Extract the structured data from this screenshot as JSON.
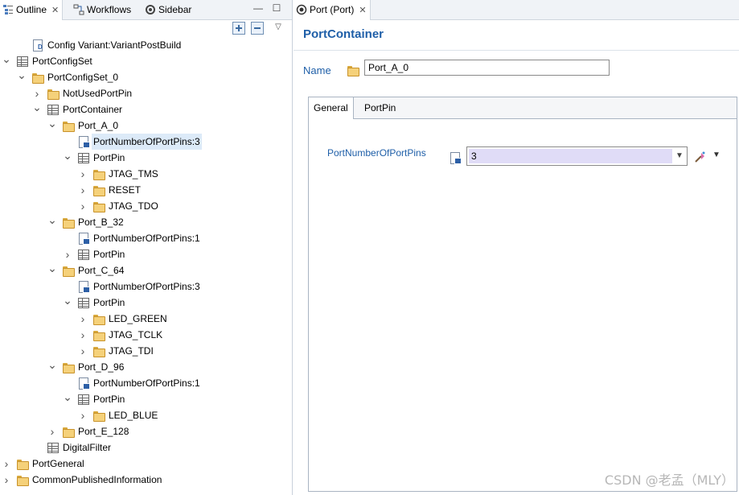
{
  "left_tabs": [
    {
      "label": "Outline",
      "icon": "outline-icon",
      "active": true,
      "closable": true
    },
    {
      "label": "Workflows",
      "icon": "workflows-icon",
      "active": false
    },
    {
      "label": "Sidebar",
      "icon": "sidebar-icon",
      "active": false
    }
  ],
  "tree": [
    {
      "label": "Config Variant:VariantPostBuild",
      "icon": "variant-doc-icon",
      "level": 1,
      "expander": "none"
    },
    {
      "label": "PortConfigSet",
      "icon": "table-icon",
      "level": 0,
      "expander": "expanded"
    },
    {
      "label": "PortConfigSet_0",
      "icon": "folder-icon",
      "level": 1,
      "expander": "expanded"
    },
    {
      "label": "NotUsedPortPin",
      "icon": "folder-icon",
      "level": 2,
      "expander": "collapsed"
    },
    {
      "label": "PortContainer",
      "icon": "table-icon",
      "level": 2,
      "expander": "expanded"
    },
    {
      "label": "Port_A_0",
      "icon": "folder-icon",
      "level": 3,
      "expander": "expanded"
    },
    {
      "label": "PortNumberOfPortPins:3",
      "icon": "parameter-icon",
      "level": 4,
      "expander": "none",
      "selected": true
    },
    {
      "label": "PortPin",
      "icon": "table-icon",
      "level": 4,
      "expander": "expanded"
    },
    {
      "label": "JTAG_TMS",
      "icon": "folder-icon",
      "level": 5,
      "expander": "collapsed"
    },
    {
      "label": "RESET",
      "icon": "folder-icon",
      "level": 5,
      "expander": "collapsed"
    },
    {
      "label": "JTAG_TDO",
      "icon": "folder-icon",
      "level": 5,
      "expander": "collapsed"
    },
    {
      "label": "Port_B_32",
      "icon": "folder-icon",
      "level": 3,
      "expander": "expanded"
    },
    {
      "label": "PortNumberOfPortPins:1",
      "icon": "parameter-icon",
      "level": 4,
      "expander": "none"
    },
    {
      "label": "PortPin",
      "icon": "table-icon",
      "level": 4,
      "expander": "collapsed"
    },
    {
      "label": "Port_C_64",
      "icon": "folder-icon",
      "level": 3,
      "expander": "expanded"
    },
    {
      "label": "PortNumberOfPortPins:3",
      "icon": "parameter-icon",
      "level": 4,
      "expander": "none"
    },
    {
      "label": "PortPin",
      "icon": "table-icon",
      "level": 4,
      "expander": "expanded"
    },
    {
      "label": "LED_GREEN",
      "icon": "folder-icon",
      "level": 5,
      "expander": "collapsed"
    },
    {
      "label": "JTAG_TCLK",
      "icon": "folder-icon",
      "level": 5,
      "expander": "collapsed"
    },
    {
      "label": "JTAG_TDI",
      "icon": "folder-icon",
      "level": 5,
      "expander": "collapsed"
    },
    {
      "label": "Port_D_96",
      "icon": "folder-icon",
      "level": 3,
      "expander": "expanded"
    },
    {
      "label": "PortNumberOfPortPins:1",
      "icon": "parameter-icon",
      "level": 4,
      "expander": "none"
    },
    {
      "label": "PortPin",
      "icon": "table-icon",
      "level": 4,
      "expander": "expanded"
    },
    {
      "label": "LED_BLUE",
      "icon": "folder-icon",
      "level": 5,
      "expander": "collapsed"
    },
    {
      "label": "Port_E_128",
      "icon": "folder-icon",
      "level": 3,
      "expander": "collapsed"
    },
    {
      "label": "DigitalFilter",
      "icon": "table-icon",
      "level": 2,
      "expander": "none"
    },
    {
      "label": "PortGeneral",
      "icon": "folder-icon",
      "level": 0,
      "expander": "collapsed"
    },
    {
      "label": "CommonPublishedInformation",
      "icon": "folder-icon",
      "level": 0,
      "expander": "collapsed"
    }
  ],
  "editor": {
    "tab_label": "Port (Port)",
    "title": "PortContainer",
    "name_label": "Name",
    "name_value": "Port_A_0",
    "subtabs": [
      {
        "label": "General",
        "active": true
      },
      {
        "label": "PortPin",
        "active": false
      }
    ],
    "field_label": "PortNumberOfPortPins",
    "field_value": "3"
  },
  "watermark": "CSDN @老孟（MLY）",
  "colors": {
    "accent_blue": "#1f5fa8",
    "selection": "#dceaf8",
    "combo_value_bg": "#e0dcf7",
    "tabbar_bg": "#f0f3f7"
  }
}
